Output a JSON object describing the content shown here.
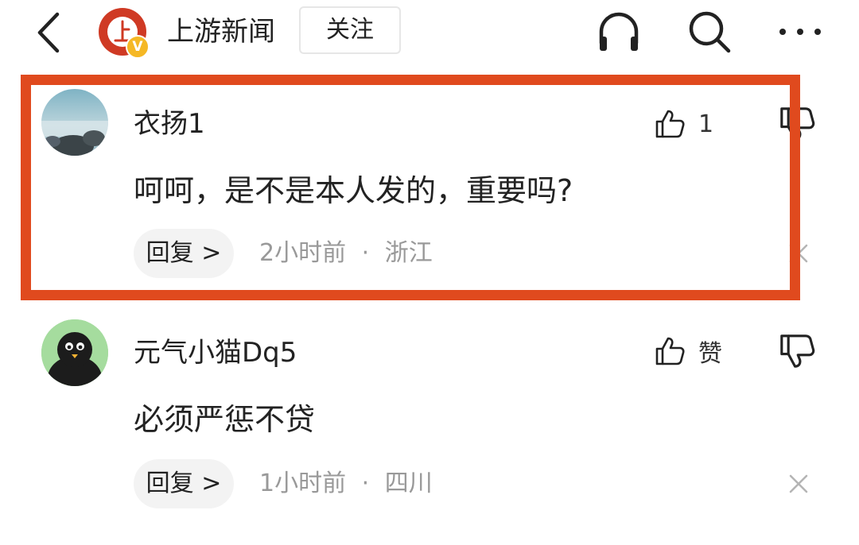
{
  "header": {
    "account_name": "上游新闻",
    "follow_label": "关注",
    "logo_badge": "V",
    "icons": [
      "back-arrow-icon",
      "headphones-icon",
      "search-icon",
      "more-icon"
    ]
  },
  "comments": [
    {
      "username": "衣扬1",
      "text": "呵呵，是不是本人发的，重要吗?",
      "like_label": "1",
      "reply_label": "回复 >",
      "time": "2小时前",
      "separator": "·",
      "location": "浙江",
      "highlighted": true
    },
    {
      "username": "元气小猫Dq5",
      "text": "必须严惩不贷",
      "like_label": "赞",
      "reply_label": "回复 >",
      "time": "1小时前",
      "separator": "·",
      "location": "四川",
      "highlighted": false
    }
  ],
  "colors": {
    "highlight_border": "#e04a1e",
    "brand_red": "#cf3a24",
    "verified_yellow": "#f5b825",
    "meta_gray": "#999999"
  }
}
